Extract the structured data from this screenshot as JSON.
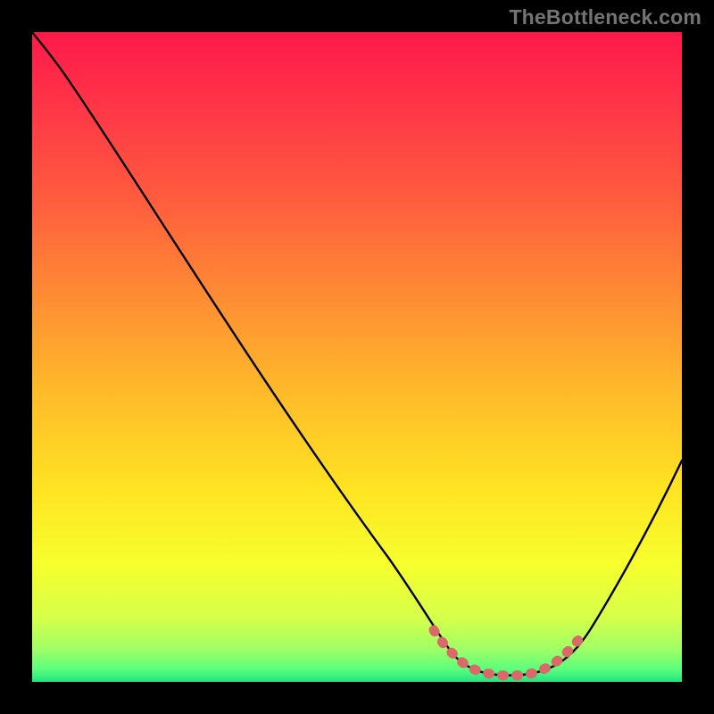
{
  "watermark": "TheBottleneck.com",
  "chart_data": {
    "type": "line",
    "title": "",
    "xlabel": "",
    "ylabel": "",
    "xlim": [
      0,
      100
    ],
    "ylim": [
      0,
      100
    ],
    "grid": false,
    "legend": false,
    "series": [
      {
        "name": "bottleneck-curve",
        "color": "#000000",
        "x": [
          0,
          4,
          8,
          15,
          25,
          35,
          45,
          55,
          61,
          64,
          67,
          72,
          77,
          81,
          84,
          88,
          92,
          96,
          100
        ],
        "y": [
          100,
          96,
          92,
          85,
          71,
          57,
          42,
          27,
          15,
          9,
          5,
          1.5,
          1.2,
          3,
          7,
          14,
          23,
          33,
          44
        ]
      },
      {
        "name": "optimal-range-highlight",
        "color": "#e06666",
        "x": [
          62,
          64,
          66,
          68,
          70,
          72,
          74,
          76,
          78,
          80,
          82
        ],
        "y": [
          8,
          6,
          4.5,
          3,
          2,
          1.5,
          1.2,
          1.4,
          2.2,
          3.6,
          6
        ]
      }
    ],
    "background_gradient": {
      "stops": [
        {
          "offset": 0.0,
          "color": "#ff194a"
        },
        {
          "offset": 0.12,
          "color": "#ff3747"
        },
        {
          "offset": 0.25,
          "color": "#ff5a3e"
        },
        {
          "offset": 0.4,
          "color": "#ff8a34"
        },
        {
          "offset": 0.55,
          "color": "#ffb92a"
        },
        {
          "offset": 0.7,
          "color": "#ffe322"
        },
        {
          "offset": 0.82,
          "color": "#f6ff2d"
        },
        {
          "offset": 0.9,
          "color": "#d7ff4a"
        },
        {
          "offset": 0.95,
          "color": "#9fff66"
        },
        {
          "offset": 0.98,
          "color": "#5dff7d"
        },
        {
          "offset": 1.0,
          "color": "#21e47e"
        }
      ]
    }
  }
}
